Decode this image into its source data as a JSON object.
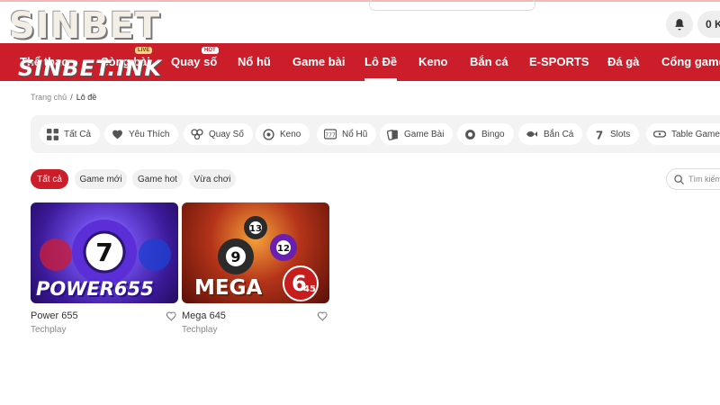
{
  "brand": {
    "logo": "SINBET",
    "watermark": "SINBET.INK"
  },
  "header": {
    "balance": "0 K",
    "bell_icon": "bell-icon"
  },
  "nav": {
    "items": [
      {
        "label": "Thể thao"
      },
      {
        "label": "Sòng bài",
        "badge": "LIVE"
      },
      {
        "label": "Quay số",
        "badge": "HOT"
      },
      {
        "label": "Nổ hũ"
      },
      {
        "label": "Game bài"
      },
      {
        "label": "Lô Đề"
      },
      {
        "label": "Keno"
      },
      {
        "label": "Bắn cá"
      },
      {
        "label": "E-SPORTS"
      },
      {
        "label": "Đá gà"
      },
      {
        "label": "Cổng game"
      }
    ],
    "active": "Lô Đề"
  },
  "breadcrumb": {
    "home": "Trang chủ",
    "separator": "/",
    "current": "Lô đề"
  },
  "categories": [
    {
      "label": "Tất Cả",
      "icon": "grid-icon"
    },
    {
      "label": "Yêu Thích",
      "icon": "heart-icon"
    },
    {
      "label": "Quay Số",
      "icon": "lottery-balls-icon"
    },
    {
      "label": "Keno",
      "icon": "keno-icon"
    },
    {
      "label": "Nổ Hũ",
      "icon": "jackpot-icon"
    },
    {
      "label": "Game Bài",
      "icon": "cards-icon"
    },
    {
      "label": "Bingo",
      "icon": "bingo-icon"
    },
    {
      "label": "Bắn Cá",
      "icon": "fish-icon"
    },
    {
      "label": "Slots",
      "icon": "slots-icon"
    },
    {
      "label": "Table Games",
      "icon": "table-games-icon"
    }
  ],
  "filters": [
    {
      "label": "Tất cả",
      "active": true
    },
    {
      "label": "Game mới",
      "active": false
    },
    {
      "label": "Game hot",
      "active": false
    },
    {
      "label": "Vừa chơi",
      "active": false
    }
  ],
  "search": {
    "placeholder": "Tìm kiếm"
  },
  "games": [
    {
      "name": "Power 655",
      "provider": "Techplay",
      "thumb_title": "POWER655",
      "ball": "7"
    },
    {
      "name": "Mega 645",
      "provider": "Techplay",
      "thumb_title": "MEGA",
      "thumb_number": "6",
      "thumb_sub": "45",
      "balls": [
        "9",
        "13",
        "12"
      ]
    }
  ],
  "colors": {
    "accent": "#cc1e2a",
    "chip_bg": "#f3f3f3"
  }
}
